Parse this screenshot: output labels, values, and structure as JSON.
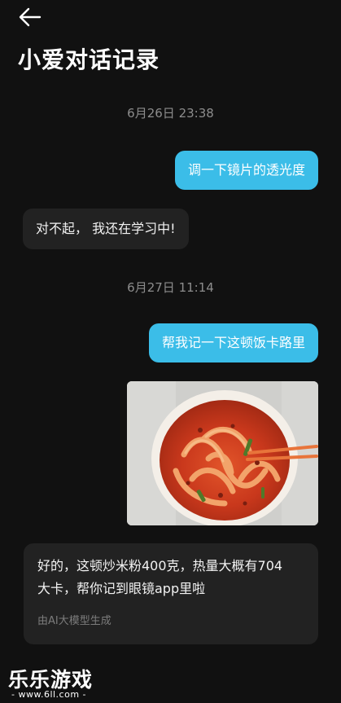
{
  "header": {
    "back_icon": "back-arrow-icon",
    "title": "小爱对话记录"
  },
  "conversation": [
    {
      "type": "timestamp",
      "text": "6月26日 23:38"
    },
    {
      "type": "user",
      "text": "调一下镜片的透光度"
    },
    {
      "type": "assistant",
      "text": "对不起， 我还在学习中!"
    },
    {
      "type": "timestamp",
      "text": "6月27日 11:14"
    },
    {
      "type": "user",
      "text": "帮我记一下这顿饭卡路里"
    },
    {
      "type": "user_image",
      "icon": "photo-of-stir-fried-rice-noodles"
    },
    {
      "type": "assistant",
      "lines": [
        "好的，这顿炒米粉400克，热量大概有704",
        "大卡，帮你记到眼镜app里啦"
      ],
      "note": "由AI大模型生成"
    }
  ],
  "watermark": {
    "main": "乐乐游戏",
    "sub": "- www.6ll.com -"
  },
  "colors": {
    "background": "#111111",
    "user_bubble": "#3bbde8",
    "assistant_bubble": "#222222",
    "timestamp": "#8d8d8d"
  }
}
